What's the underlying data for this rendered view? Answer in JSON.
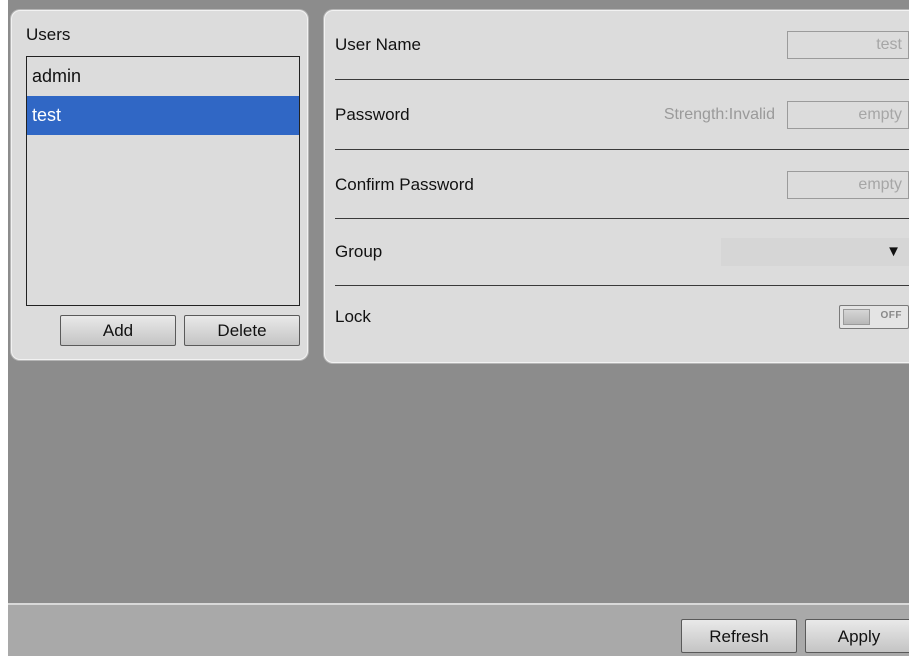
{
  "users_panel": {
    "title": "Users",
    "users": [
      "admin",
      "test"
    ],
    "selected_user": "test",
    "add_label": "Add",
    "delete_label": "Delete"
  },
  "details": {
    "user_name": {
      "label": "User Name",
      "value": "test"
    },
    "password": {
      "label": "Password",
      "strength": "Strength:Invalid",
      "value": "empty"
    },
    "confirm_password": {
      "label": "Confirm Password",
      "value": "empty"
    },
    "group": {
      "label": "Group",
      "value": "",
      "icon": "triangle-down-icon"
    },
    "lock": {
      "label": "Lock",
      "state": "OFF"
    }
  },
  "footer": {
    "refresh_label": "Refresh",
    "apply_label": "Apply"
  },
  "colors": {
    "selection": "#3067c5",
    "panel_bg": "#dcdcdc",
    "app_bg": "#8c8c8c"
  }
}
